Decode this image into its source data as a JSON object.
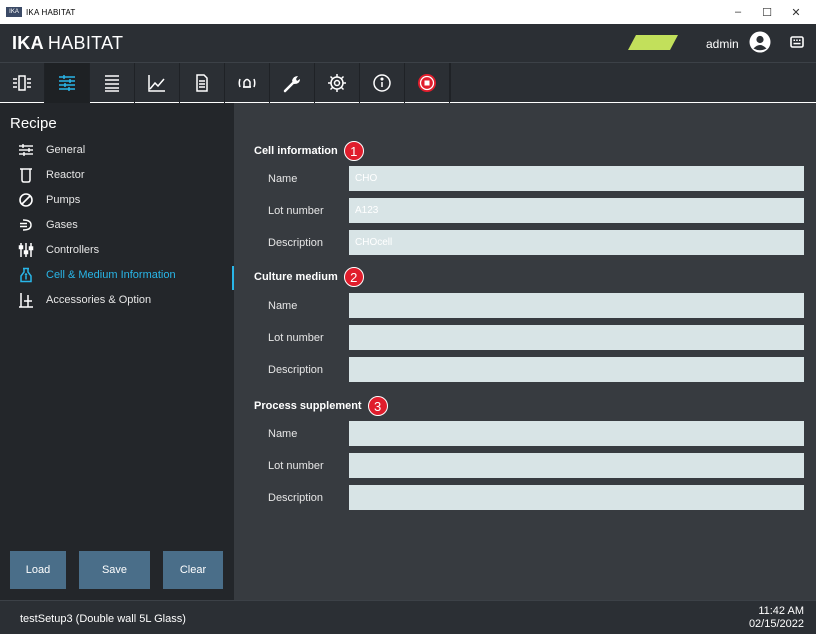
{
  "window": {
    "title": "IKA HABITAT",
    "logo_text": "IKA",
    "controls": {
      "minimize": "–",
      "maximize": "☐",
      "close": "✕"
    }
  },
  "header": {
    "brand_bold": "IKA",
    "brand_rest": "HABITAT",
    "status_color": "#c2e05b",
    "user": "admin",
    "icons": [
      "user-icon",
      "keyboard-icon"
    ]
  },
  "toolbar": {
    "buttons": [
      {
        "name": "tab-overview",
        "icon": "overview-icon"
      },
      {
        "name": "tab-recipe",
        "icon": "recipe-settings-icon",
        "active": true
      },
      {
        "name": "tab-list",
        "icon": "list-icon"
      },
      {
        "name": "tab-trends",
        "icon": "chart-icon"
      },
      {
        "name": "tab-documents",
        "icon": "document-icon"
      },
      {
        "name": "tab-alarms",
        "icon": "alarm-icon"
      },
      {
        "name": "tab-tools",
        "icon": "wrench-icon"
      },
      {
        "name": "tab-settings",
        "icon": "gear-icon"
      },
      {
        "name": "tab-info",
        "icon": "info-icon"
      },
      {
        "name": "tab-stop",
        "icon": "stop-icon"
      }
    ],
    "accent": "#29b6e8",
    "stop_color": "#e01d2c"
  },
  "sidebar": {
    "title": "Recipe",
    "items": [
      {
        "label": "General",
        "icon": "sliders-icon"
      },
      {
        "label": "Reactor",
        "icon": "reactor-icon"
      },
      {
        "label": "Pumps",
        "icon": "pump-icon"
      },
      {
        "label": "Gases",
        "icon": "gas-icon"
      },
      {
        "label": "Controllers",
        "icon": "controllers-icon"
      },
      {
        "label": "Cell & Medium Information",
        "icon": "flask-icon",
        "active": true
      },
      {
        "label": "Accessories & Option",
        "icon": "accessories-icon"
      }
    ],
    "buttons": {
      "load": "Load",
      "save": "Save",
      "clear": "Clear"
    }
  },
  "main": {
    "sections": [
      {
        "title": "Cell information",
        "badge": "1",
        "fields": [
          {
            "label": "Name",
            "value": "CHO"
          },
          {
            "label": "Lot number",
            "value": "A123"
          },
          {
            "label": "Description",
            "value": "CHOcell"
          }
        ]
      },
      {
        "title": "Culture medium",
        "badge": "2",
        "fields": [
          {
            "label": "Name",
            "value": ""
          },
          {
            "label": "Lot number",
            "value": ""
          },
          {
            "label": "Description",
            "value": ""
          }
        ]
      },
      {
        "title": "Process supplement",
        "badge": "3",
        "fields": [
          {
            "label": "Name",
            "value": ""
          },
          {
            "label": "Lot number",
            "value": ""
          },
          {
            "label": "Description",
            "value": ""
          }
        ]
      }
    ]
  },
  "statusbar": {
    "setup": "testSetup3 (Double wall 5L Glass)",
    "time": "11:42 AM",
    "date": "02/15/2022"
  }
}
